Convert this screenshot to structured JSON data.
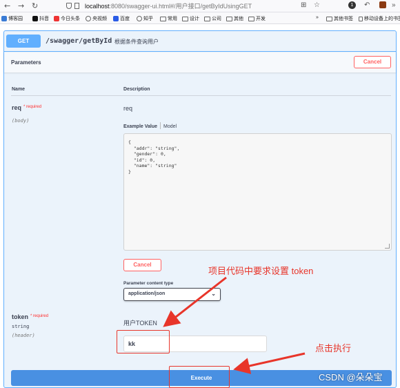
{
  "browser": {
    "url_host": "localhost",
    "url_rest": ":8080/swagger-ui.html#/用户接口/getByIdUsingGET",
    "bookmarks": [
      "博客园",
      "抖音",
      "今日头条",
      "央视频",
      "百度",
      "知乎",
      "常用",
      "设计",
      "公司",
      "其他",
      "开发"
    ],
    "other_bookmarks": "其他书签",
    "mobile_bookmarks": "移动设备上的书签",
    "badge_count": "1"
  },
  "operation": {
    "method": "GET",
    "path": "/swagger/getById",
    "description": "根据条件查询用户"
  },
  "parameters": {
    "title": "Parameters",
    "cancel_label": "Cancel",
    "col_name": "Name",
    "col_description": "Description",
    "req": {
      "name": "req",
      "required": "* required",
      "in": "(body)",
      "description": "req",
      "tab_example": "Example Value",
      "tab_model": "Model",
      "body": "{\n  \"addr\": \"string\",\n  \"gender\": 0,\n  \"id\": 0,\n  \"name\": \"string\"\n}",
      "cancel_label": "Cancel",
      "content_type_label": "Parameter content type",
      "content_type_value": "application/json"
    },
    "token": {
      "name": "token",
      "required": "* required",
      "type": "string",
      "in": "(header)",
      "description": "用户TOKEN",
      "value": "kk"
    }
  },
  "execute_label": "Execute",
  "annotations": {
    "token_note": "项目代码中要求设置 token",
    "execute_note": "点击执行"
  },
  "watermark": "CSDN @朵朵宝",
  "colors": {
    "get_blue": "#61affe",
    "execute_blue": "#4990e2",
    "cancel_red": "#ff6060",
    "annotation_red": "#e8352a"
  }
}
